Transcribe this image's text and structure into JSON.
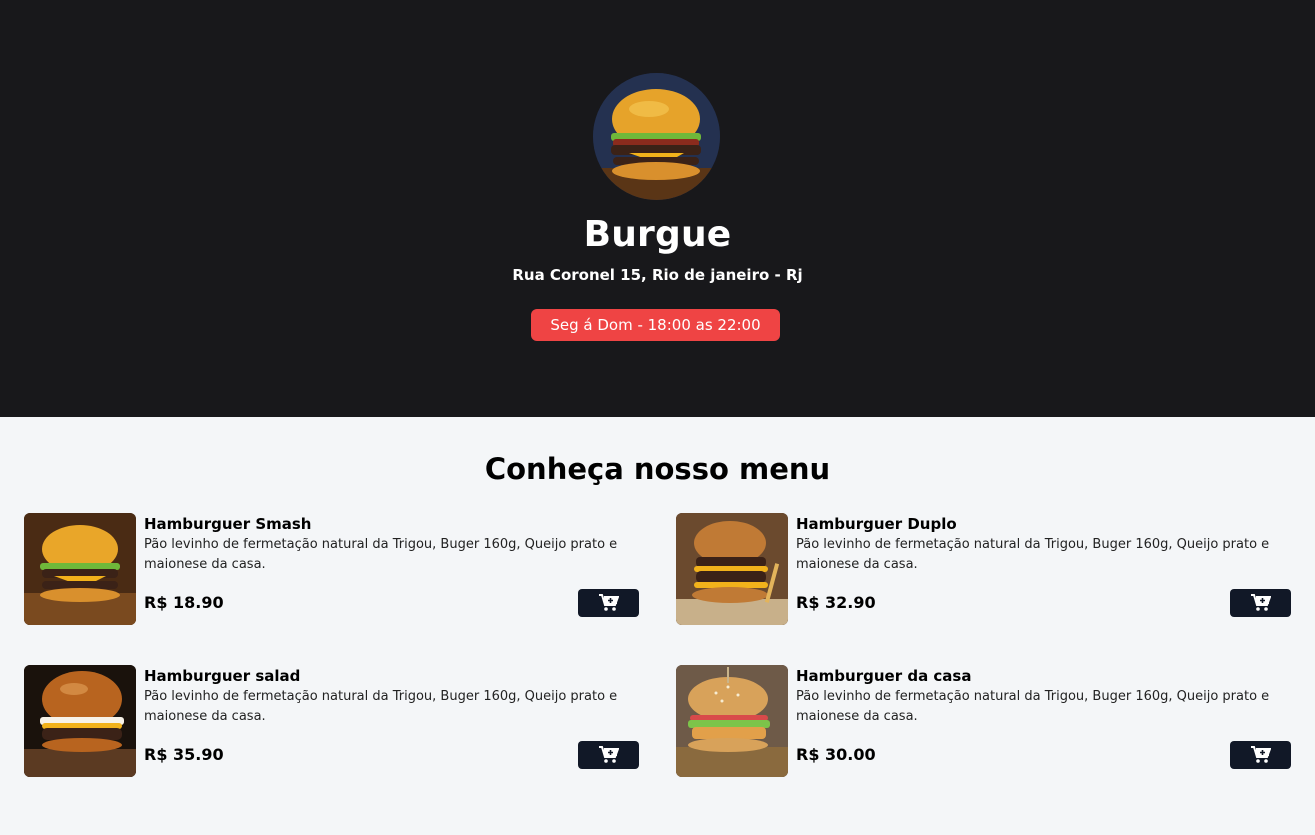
{
  "header": {
    "logo": {
      "icon": "burger-logo-image"
    },
    "title": "Burgue",
    "address": "Rua Coronel 15, Rio de janeiro - Rj",
    "hours": "Seg á Dom - 18:00 as 22:00",
    "hours_color": "#ef4444"
  },
  "menu": {
    "title": "Conheça nosso menu",
    "items": [
      {
        "name": "Hamburguer Smash",
        "description": "Pão levinho de fermetação natural da Trigou, Buger 160g, Queijo prato e maionese da casa.",
        "price": "R$ 18.90",
        "cart_icon": "add-to-cart-icon"
      },
      {
        "name": "Hamburguer Duplo",
        "description": "Pão levinho de fermetação natural da Trigou, Buger 160g, Queijo prato e maionese da casa.",
        "price": "R$ 32.90",
        "cart_icon": "add-to-cart-icon"
      },
      {
        "name": "Hamburguer salad",
        "description": "Pão levinho de fermetação natural da Trigou, Buger 160g, Queijo prato e maionese da casa.",
        "price": "R$ 35.90",
        "cart_icon": "add-to-cart-icon"
      },
      {
        "name": "Hamburguer da casa",
        "description": "Pão levinho de fermetação natural da Trigou, Buger 160g, Queijo prato e maionese da casa.",
        "price": "R$ 30.00",
        "cart_icon": "add-to-cart-icon"
      }
    ]
  },
  "colors": {
    "header_bg": "#18181b",
    "page_bg": "#f4f6f8",
    "button_bg": "#111827"
  }
}
